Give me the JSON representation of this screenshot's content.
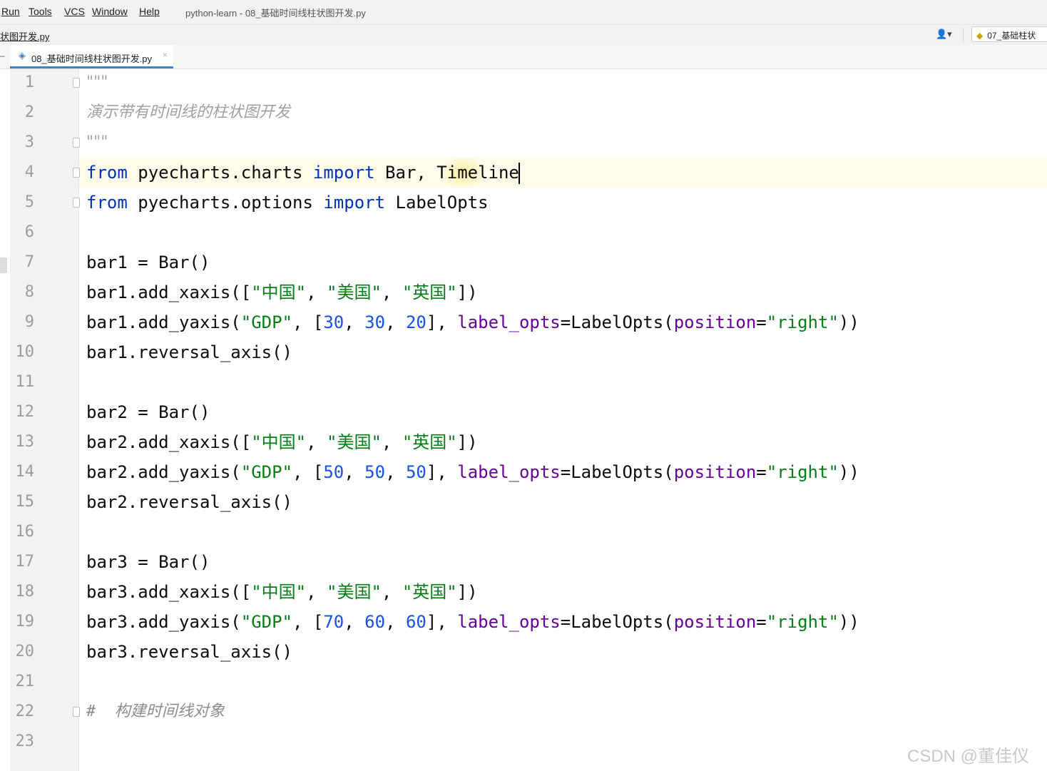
{
  "menubar": {
    "items": [
      "Run",
      "Tools",
      "VCS",
      "Window",
      "Help"
    ],
    "window_title": "python-learn - 08_基础时间线柱状图开发.py"
  },
  "navbar": {
    "breadcrumb": "状图开发.py",
    "user_label": "👤▾",
    "run_config": "07_基础柱状"
  },
  "tabs": [
    {
      "label": "08_基础时间线柱状图开发.py",
      "active": true,
      "close": "×"
    }
  ],
  "editor": {
    "current_line": 4,
    "lines": [
      {
        "n": "1",
        "kind": "doc",
        "tokens": [
          {
            "t": "\"\"\""
          }
        ]
      },
      {
        "n": "2",
        "kind": "doc",
        "tokens": [
          {
            "t": "演示带有时间线的柱状图开发"
          }
        ]
      },
      {
        "n": "3",
        "kind": "doc",
        "tokens": [
          {
            "t": "\"\"\""
          }
        ]
      },
      {
        "n": "4",
        "kind": "code",
        "tokens": [
          {
            "t": "from",
            "c": "k"
          },
          {
            "t": " pyecharts.charts "
          },
          {
            "t": "import",
            "c": "k"
          },
          {
            "t": " Bar, Timeline"
          }
        ]
      },
      {
        "n": "5",
        "kind": "code",
        "tokens": [
          {
            "t": "from",
            "c": "k"
          },
          {
            "t": " pyecharts.options "
          },
          {
            "t": "import",
            "c": "k"
          },
          {
            "t": " LabelOpts"
          }
        ]
      },
      {
        "n": "6",
        "kind": "code",
        "tokens": []
      },
      {
        "n": "7",
        "kind": "code",
        "tokens": [
          {
            "t": "bar1 = Bar()"
          }
        ]
      },
      {
        "n": "8",
        "kind": "code",
        "tokens": [
          {
            "t": "bar1.add_xaxis(["
          },
          {
            "t": "\"中国\"",
            "c": "s"
          },
          {
            "t": ", "
          },
          {
            "t": "\"美国\"",
            "c": "s"
          },
          {
            "t": ", "
          },
          {
            "t": "\"英国\"",
            "c": "s"
          },
          {
            "t": "])"
          }
        ]
      },
      {
        "n": "9",
        "kind": "code",
        "tokens": [
          {
            "t": "bar1.add_yaxis("
          },
          {
            "t": "\"GDP\"",
            "c": "s"
          },
          {
            "t": ", ["
          },
          {
            "t": "30",
            "c": "n"
          },
          {
            "t": ", "
          },
          {
            "t": "30",
            "c": "n"
          },
          {
            "t": ", "
          },
          {
            "t": "20",
            "c": "n"
          },
          {
            "t": "], "
          },
          {
            "t": "label_opts",
            "c": "p"
          },
          {
            "t": "=LabelOpts("
          },
          {
            "t": "position",
            "c": "p"
          },
          {
            "t": "="
          },
          {
            "t": "\"right\"",
            "c": "s"
          },
          {
            "t": "))"
          }
        ]
      },
      {
        "n": "10",
        "kind": "code",
        "tokens": [
          {
            "t": "bar1.reversal_axis()"
          }
        ]
      },
      {
        "n": "11",
        "kind": "code",
        "tokens": []
      },
      {
        "n": "12",
        "kind": "code",
        "tokens": [
          {
            "t": "bar2 = Bar()"
          }
        ]
      },
      {
        "n": "13",
        "kind": "code",
        "tokens": [
          {
            "t": "bar2.add_xaxis(["
          },
          {
            "t": "\"中国\"",
            "c": "s"
          },
          {
            "t": ", "
          },
          {
            "t": "\"美国\"",
            "c": "s"
          },
          {
            "t": ", "
          },
          {
            "t": "\"英国\"",
            "c": "s"
          },
          {
            "t": "])"
          }
        ]
      },
      {
        "n": "14",
        "kind": "code",
        "tokens": [
          {
            "t": "bar2.add_yaxis("
          },
          {
            "t": "\"GDP\"",
            "c": "s"
          },
          {
            "t": ", ["
          },
          {
            "t": "50",
            "c": "n"
          },
          {
            "t": ", "
          },
          {
            "t": "50",
            "c": "n"
          },
          {
            "t": ", "
          },
          {
            "t": "50",
            "c": "n"
          },
          {
            "t": "], "
          },
          {
            "t": "label_opts",
            "c": "p"
          },
          {
            "t": "=LabelOpts("
          },
          {
            "t": "position",
            "c": "p"
          },
          {
            "t": "="
          },
          {
            "t": "\"right\"",
            "c": "s"
          },
          {
            "t": "))"
          }
        ]
      },
      {
        "n": "15",
        "kind": "code",
        "tokens": [
          {
            "t": "bar2.reversal_axis()"
          }
        ]
      },
      {
        "n": "16",
        "kind": "code",
        "tokens": []
      },
      {
        "n": "17",
        "kind": "code",
        "tokens": [
          {
            "t": "bar3 = Bar()"
          }
        ]
      },
      {
        "n": "18",
        "kind": "code",
        "tokens": [
          {
            "t": "bar3.add_xaxis(["
          },
          {
            "t": "\"中国\"",
            "c": "s"
          },
          {
            "t": ", "
          },
          {
            "t": "\"美国\"",
            "c": "s"
          },
          {
            "t": ", "
          },
          {
            "t": "\"英国\"",
            "c": "s"
          },
          {
            "t": "])"
          }
        ]
      },
      {
        "n": "19",
        "kind": "code",
        "tokens": [
          {
            "t": "bar3.add_yaxis("
          },
          {
            "t": "\"GDP\"",
            "c": "s"
          },
          {
            "t": ", ["
          },
          {
            "t": "70",
            "c": "n"
          },
          {
            "t": ", "
          },
          {
            "t": "60",
            "c": "n"
          },
          {
            "t": ", "
          },
          {
            "t": "60",
            "c": "n"
          },
          {
            "t": "], "
          },
          {
            "t": "label_opts",
            "c": "p"
          },
          {
            "t": "=LabelOpts("
          },
          {
            "t": "position",
            "c": "p"
          },
          {
            "t": "="
          },
          {
            "t": "\"right\"",
            "c": "s"
          },
          {
            "t": "))"
          }
        ]
      },
      {
        "n": "20",
        "kind": "code",
        "tokens": [
          {
            "t": "bar3.reversal_axis()"
          }
        ]
      },
      {
        "n": "21",
        "kind": "code",
        "tokens": []
      },
      {
        "n": "22",
        "kind": "comment",
        "tokens": [
          {
            "t": "#  构建时间线对象"
          }
        ]
      },
      {
        "n": "23",
        "kind": "code",
        "tokens": []
      }
    ],
    "fold_lines": [
      1,
      3,
      4,
      5,
      22
    ]
  },
  "watermark": "CSDN @董佳仪",
  "colors": {
    "keyword": "#0033b3",
    "string": "#067d17",
    "number": "#1750eb",
    "parameter": "#660099",
    "docstring": "#a0a0a0",
    "line_number": "#9c9c9c",
    "active_tab_underline": "#4083c9"
  }
}
